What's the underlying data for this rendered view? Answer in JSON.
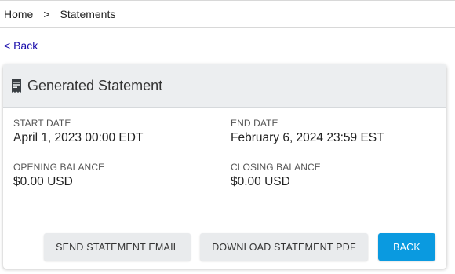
{
  "breadcrumb": {
    "home": "Home",
    "separator": ">",
    "current": "Statements"
  },
  "back_link": "< Back",
  "card": {
    "title": "Generated Statement",
    "icon": "receipt-icon",
    "fields": {
      "start_date": {
        "label": "START DATE",
        "value": "April 1, 2023 00:00 EDT"
      },
      "end_date": {
        "label": "END DATE",
        "value": "February 6, 2024 23:59 EST"
      },
      "opening_balance": {
        "label": "OPENING BALANCE",
        "value": "$0.00 USD"
      },
      "closing_balance": {
        "label": "CLOSING BALANCE",
        "value": "$0.00 USD"
      }
    },
    "buttons": {
      "send_email": "SEND STATEMENT EMAIL",
      "download_pdf": "DOWNLOAD STATEMENT PDF",
      "back": "BACK"
    }
  },
  "colors": {
    "primary": "#0a9ae0",
    "link": "#1a0dab",
    "header_bg": "#eceef0"
  }
}
